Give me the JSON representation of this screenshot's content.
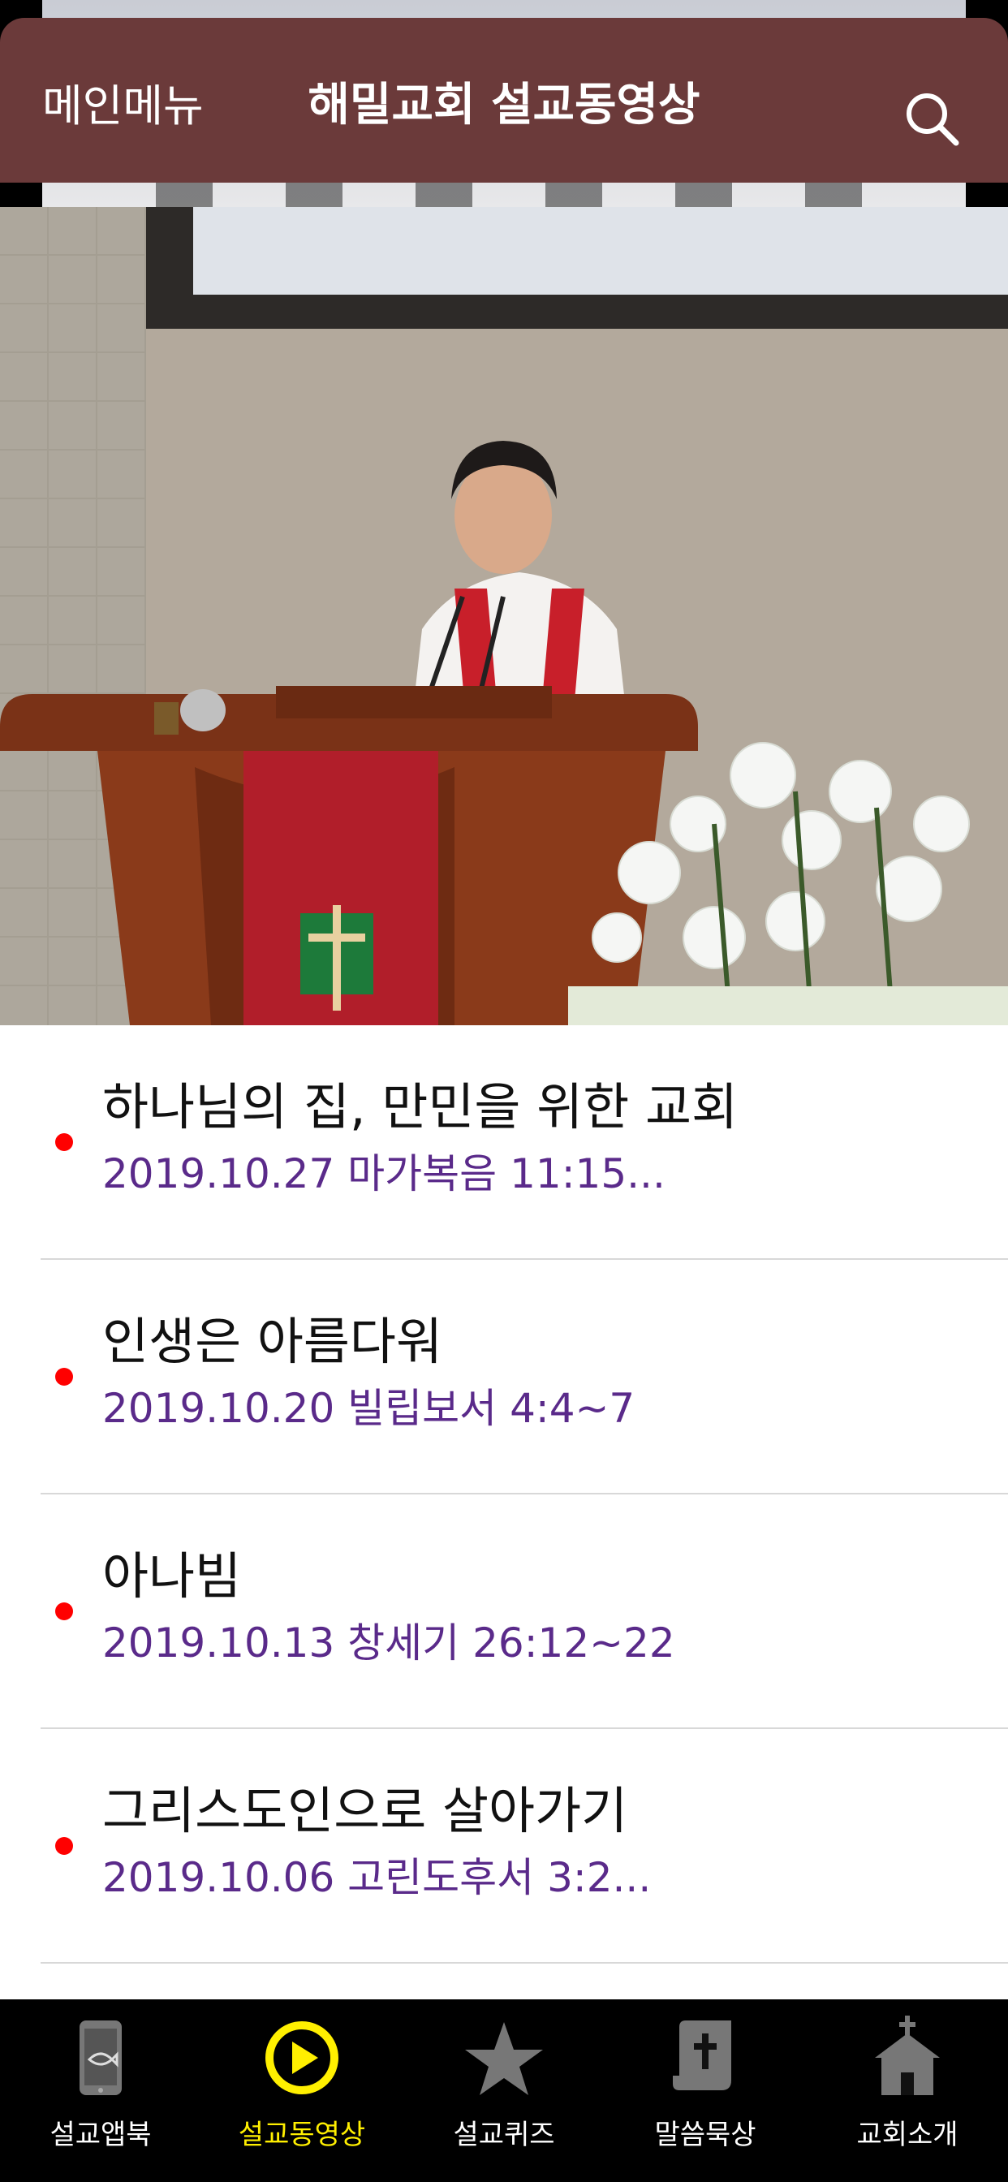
{
  "header": {
    "menu_label": "메인메뉴",
    "title": "해밀교회 설교동영상",
    "search_icon": "search-icon",
    "background_color": "#6b3a3a"
  },
  "hero": {
    "image": "pastor-preaching-at-pulpit-photo"
  },
  "sermons": [
    {
      "title": "하나님의 집, 만민을 위한 교회",
      "subtitle": "2019.10.27 마가복음 11:15..."
    },
    {
      "title": "인생은 아름다워",
      "subtitle": "2019.10.20 빌립보서 4:4~7"
    },
    {
      "title": "아나빔",
      "subtitle": "2019.10.13 창세기 26:12~22"
    },
    {
      "title": "그리스도인으로 살아가기",
      "subtitle": "2019.10.06 고린도후서 3:2..."
    }
  ],
  "colors": {
    "bullet": "#ff0000",
    "subtitle": "#5a2a8a",
    "tab_active": "#ffef00"
  },
  "tabs": [
    {
      "label": "설교앱북",
      "icon": "phone-fish-icon",
      "active": false
    },
    {
      "label": "설교동영상",
      "icon": "play-circle-icon",
      "active": true
    },
    {
      "label": "설교퀴즈",
      "icon": "star-icon",
      "active": false
    },
    {
      "label": "말씀묵상",
      "icon": "bible-cross-icon",
      "active": false
    },
    {
      "label": "교회소개",
      "icon": "church-icon",
      "active": false
    }
  ]
}
